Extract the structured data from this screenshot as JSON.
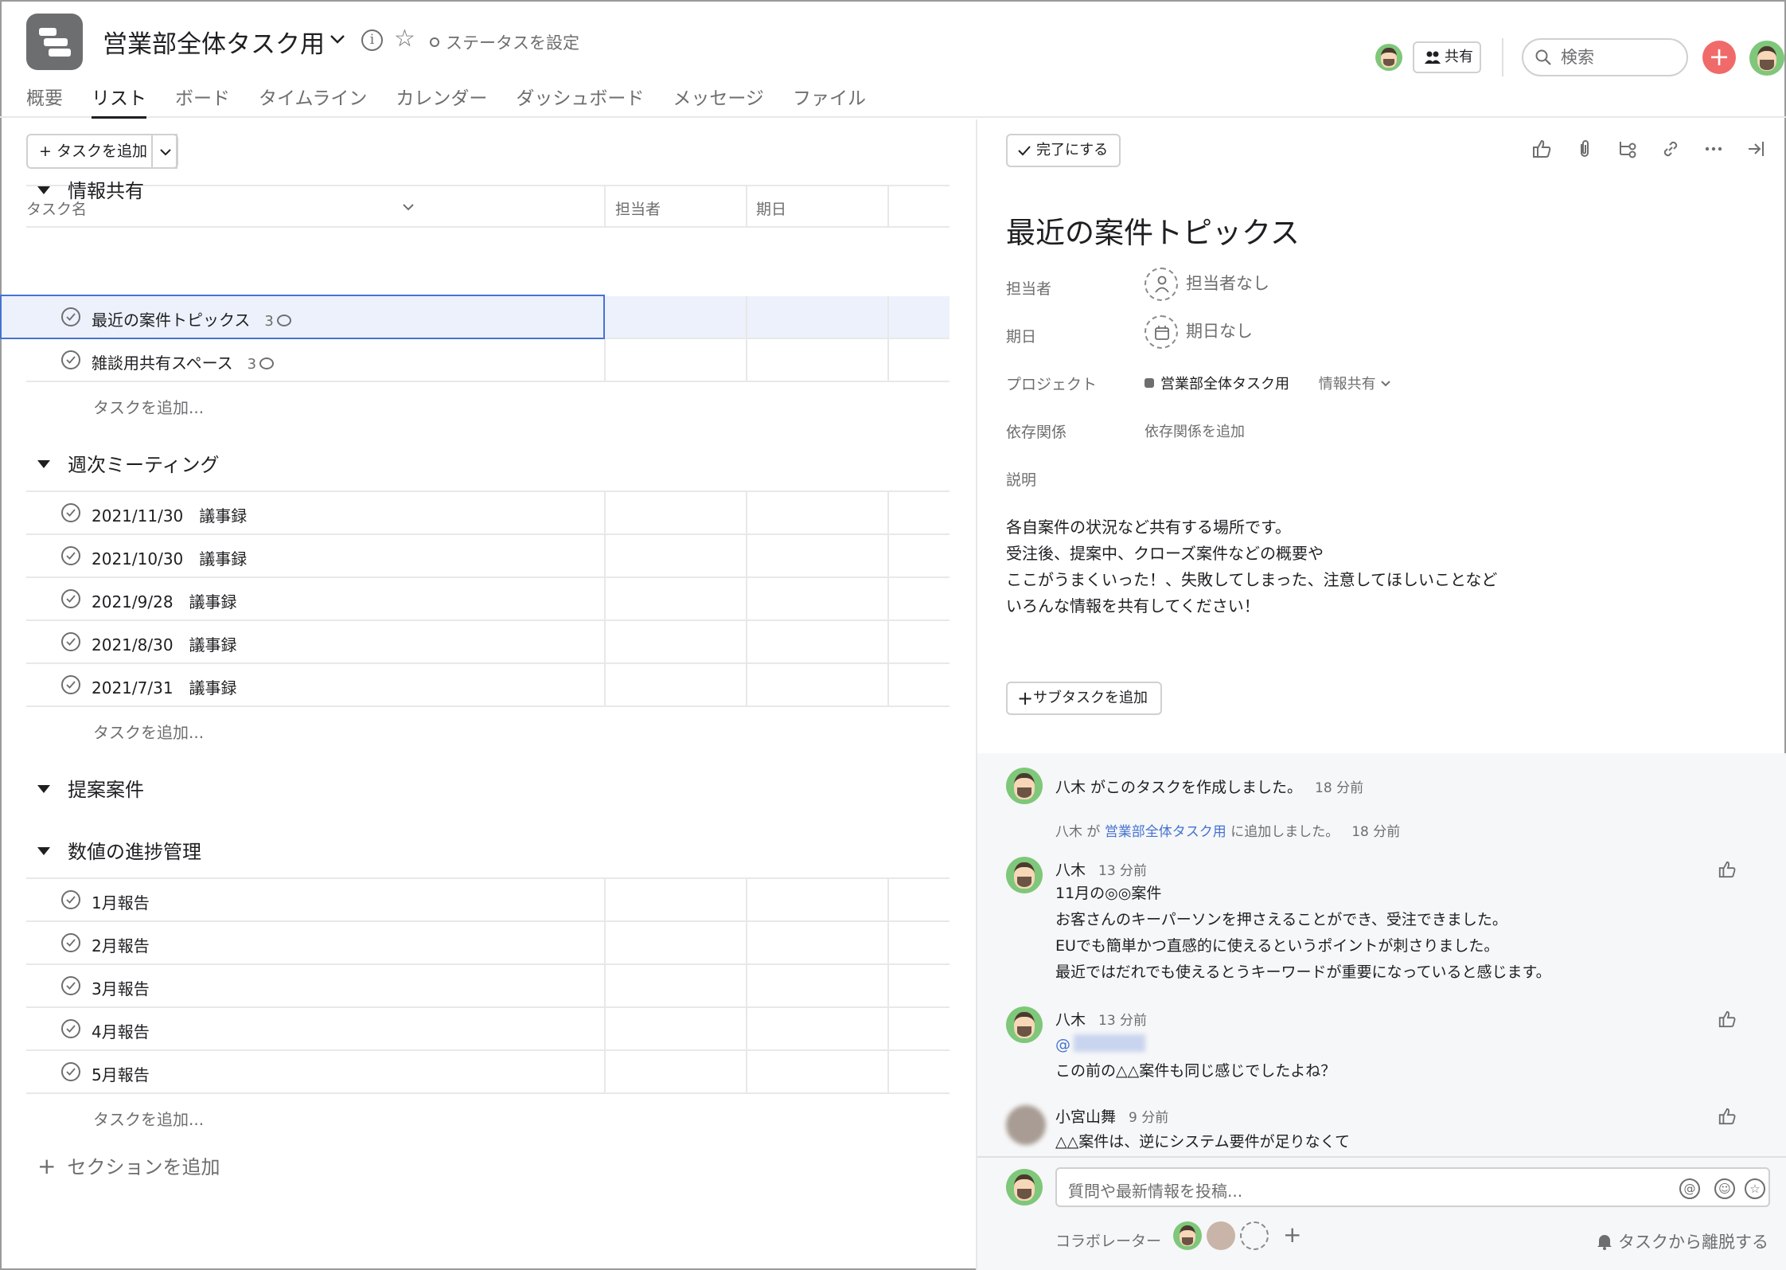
{
  "project": {
    "title": "営業部全体タスク用",
    "status_label": "ステータスを設定",
    "icon": "project-list-icon"
  },
  "tabs": [
    "概要",
    "リスト",
    "ボード",
    "タイムライン",
    "カレンダー",
    "ダッシュボード",
    "メッセージ",
    "ファイル"
  ],
  "active_tab": "リスト",
  "header_right": {
    "share_label": "共有",
    "search_placeholder": "検索",
    "add_label": "+"
  },
  "list": {
    "add_task_label": "タスクを追加",
    "columns": {
      "name": "タスク名",
      "assignee": "担当者",
      "due": "期日"
    },
    "add_row_label": "タスクを追加...",
    "add_section_label": "セクションを追加",
    "sections": [
      {
        "name": "情報共有",
        "tasks": [
          {
            "name": "最近の案件トピックス",
            "comments": "3"
          },
          {
            "name": "雑談用共有スペース",
            "comments": "3"
          }
        ]
      },
      {
        "name": "週次ミーティング",
        "tasks": [
          {
            "name": "2021/11/30　議事録"
          },
          {
            "name": "2021/10/30　議事録"
          },
          {
            "name": "2021/9/28　議事録"
          },
          {
            "name": "2021/8/30　議事録"
          },
          {
            "name": "2021/7/31　議事録"
          }
        ]
      },
      {
        "name": "提案案件",
        "tasks": []
      },
      {
        "name": "数値の進捗管理",
        "tasks": [
          {
            "name": "1月報告"
          },
          {
            "name": "2月報告"
          },
          {
            "name": "3月報告"
          },
          {
            "name": "4月報告"
          },
          {
            "name": "5月報告"
          }
        ]
      }
    ]
  },
  "detail": {
    "complete_label": "完了にする",
    "title": "最近の案件トピックス",
    "fields": {
      "assignee_label": "担当者",
      "assignee_value": "担当者なし",
      "due_label": "期日",
      "due_value": "期日なし",
      "project_label": "プロジェクト",
      "project_value": "営業部全体タスク用",
      "section_value": "情報共有",
      "deps_label": "依存関係",
      "deps_value": "依存関係を追加",
      "desc_label": "説明"
    },
    "description": [
      "各自案件の状況など共有する場所です。",
      "受注後、提案中、クローズ案件などの概要や",
      "ここがうまくいった！、失敗してしまった、注意してほしいことなど",
      "いろんな情報を共有してください！"
    ],
    "subtask_label": "サブタスクを追加"
  },
  "activity": {
    "created": {
      "text": "八木 がこのタスクを作成しました。",
      "time": "18 分前"
    },
    "added": {
      "who": "八木 が",
      "project": "営業部全体タスク用",
      "suffix": "に追加しました。",
      "time": "18 分前"
    },
    "comments": [
      {
        "author": "八木",
        "time": "13 分前",
        "lines": [
          "11月の◎◎案件",
          "お客さんのキーパーソンを押さえることができ、受注できました。",
          "EUでも簡単かつ直感的に使えるというポイントが刺さりました。",
          "最近ではだれでも使えるとうキーワードが重要になっていると感じます。"
        ]
      },
      {
        "author": "八木",
        "time": "13 分前",
        "mention": "@",
        "lines": [
          "この前の△△案件も同じ感じでしたよね？"
        ]
      },
      {
        "author": "小宮山舞",
        "time": "9 分前",
        "lines": [
          "△△案件は、逆にシステム要件が足りなくて"
        ]
      }
    ]
  },
  "composer": {
    "placeholder": "質問や最新情報を投稿...",
    "collab_label": "コラボレーター",
    "collab_add": "+",
    "leave_label": "タスクから離脱する"
  },
  "colors": {
    "accent": "#f06a6a",
    "selection": "#4573d2",
    "avatar_bg": "#7fc77a"
  }
}
